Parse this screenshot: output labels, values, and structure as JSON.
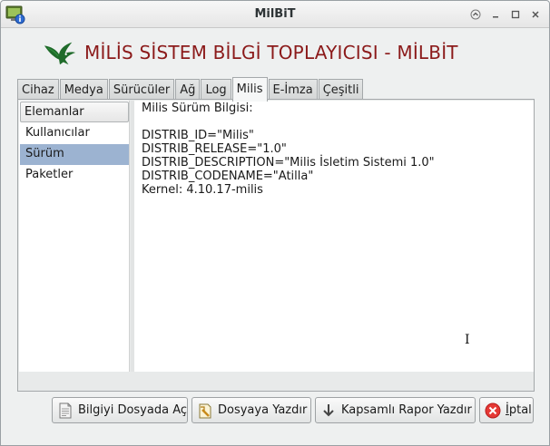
{
  "window": {
    "title": "MilBiT"
  },
  "header": {
    "title": "MİLİS SİSTEM BİLGİ TOPLAYICISI - MİLBİT"
  },
  "tabs": [
    {
      "label": "Cihaz"
    },
    {
      "label": "Medya"
    },
    {
      "label": "Sürücüler"
    },
    {
      "label": "Ağ"
    },
    {
      "label": "Log"
    },
    {
      "label": "Milis",
      "active": true
    },
    {
      "label": "E-İmza"
    },
    {
      "label": "Çeşitli"
    }
  ],
  "sidebar": {
    "header": "Elemanlar",
    "items": [
      {
        "label": "Kullanıcılar"
      },
      {
        "label": "Sürüm",
        "selected": true
      },
      {
        "label": "Paketler"
      }
    ]
  },
  "content": {
    "lines": [
      "Milis Sürüm Bilgisi:",
      "",
      "DISTRIB_ID=\"Milis\"",
      "DISTRIB_RELEASE=\"1.0\"",
      "DISTRIB_DESCRIPTION=\"Milis İsletim Sistemi 1.0\"",
      "DISTRIB_CODENAME=\"Atilla\"",
      "Kernel: 4.10.17-milis"
    ]
  },
  "buttons": {
    "open_label": "Bilgiyi Dosyada Aç",
    "save_label": "Dosyaya Yazdır",
    "report_label": "Kapsamlı Rapor Yazdır",
    "cancel_prefix": "",
    "cancel_mnemonic": "İ",
    "cancel_rest": "ptal"
  },
  "colors": {
    "header_title": "#8b1a1a",
    "selection": "#9cb3d1",
    "cancel_icon": "#e53935"
  },
  "icons": {
    "app": "app-icon",
    "logo": "eagle-logo",
    "open": "document-icon",
    "save": "write-file-icon",
    "report": "arrow-down-icon",
    "cancel": "cancel-icon",
    "minimize": "minimize-icon",
    "maximize": "maximize-icon",
    "close": "close-icon",
    "up": "up-icon"
  }
}
